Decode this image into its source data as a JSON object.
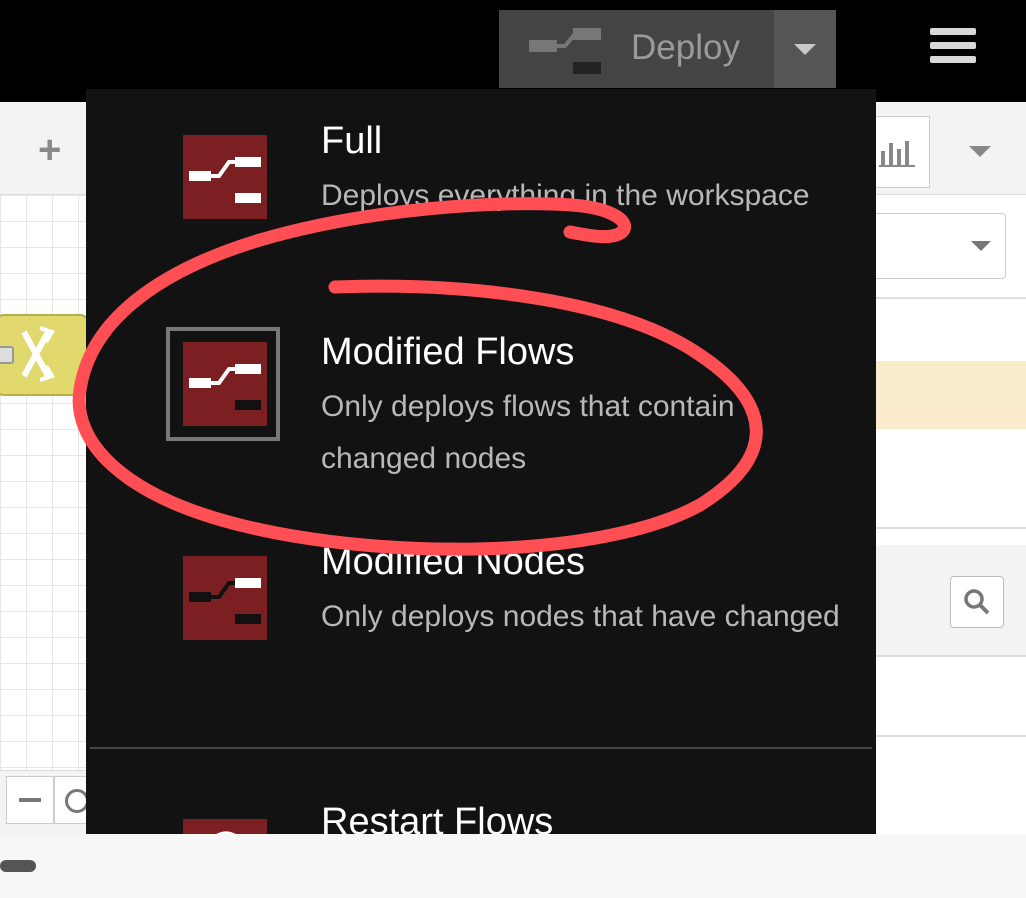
{
  "header": {
    "deploy_label": "Deploy",
    "deploy_icon": "deploy-icon",
    "dropdown_icon": "caret-down-icon",
    "menu_icon": "hamburger-menu-icon"
  },
  "colors": {
    "menu_background": "#121212",
    "icon_background": "#7c1f22",
    "annotation": "#ff4f55",
    "switch_node": "#e2d96e",
    "highlight_row": "#fbedcc"
  },
  "deploy_menu": {
    "items": [
      {
        "title": "Full",
        "description": "Deploys everything in the workspace",
        "icon": "deploy-full-icon",
        "selected": false
      },
      {
        "title": "Modified Flows",
        "description": "Only deploys flows that contain changed nodes",
        "icon": "deploy-flows-icon",
        "selected": true
      },
      {
        "title": "Modified Nodes",
        "description": "Only deploys nodes that have changed",
        "icon": "deploy-nodes-icon",
        "selected": false
      },
      {
        "title": "Restart Flows",
        "description": "",
        "icon": "restart-flows-icon",
        "selected": false
      }
    ]
  },
  "annotation": {
    "shape": "hand-drawn circle",
    "target": "Modified Flows"
  }
}
